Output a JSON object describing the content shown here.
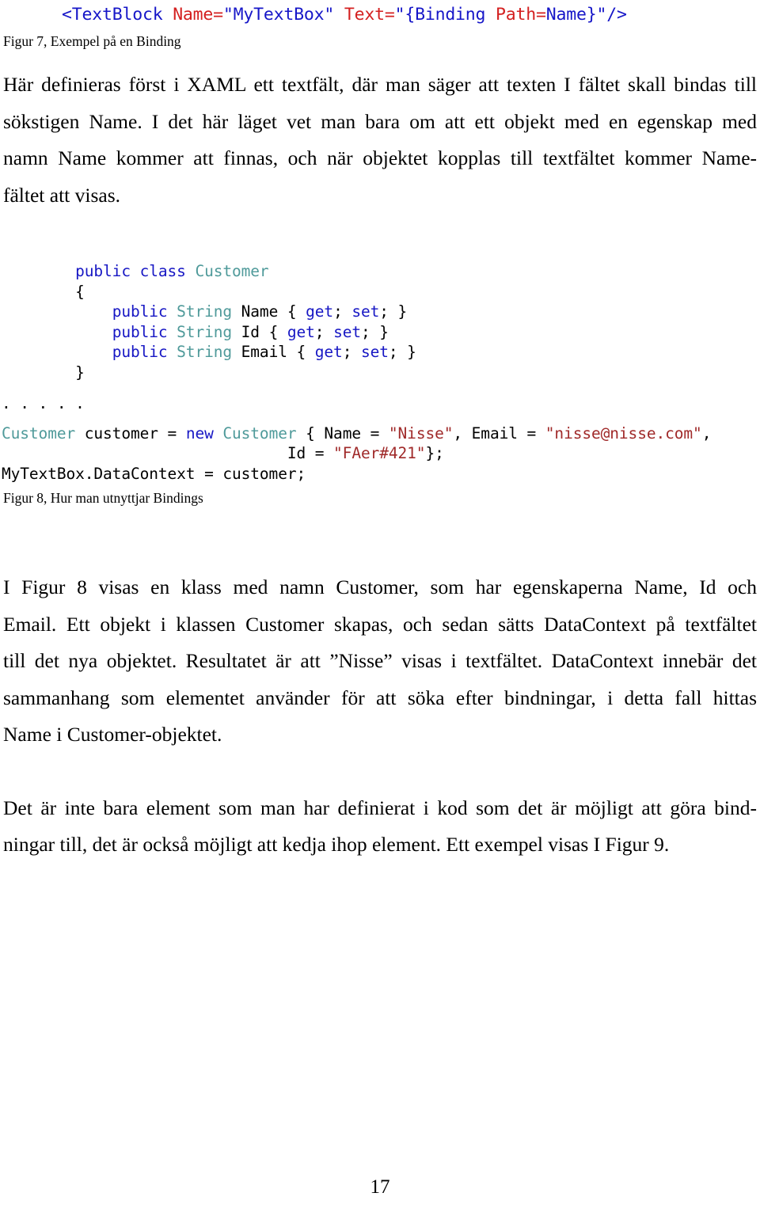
{
  "document": {
    "page_number": "17",
    "language": "sv"
  },
  "figure7": {
    "code_tokens": [
      {
        "text": "<TextBlock ",
        "kind": "tag"
      },
      {
        "text": "Name=",
        "kind": "attr"
      },
      {
        "text": "\"MyTextBox\" ",
        "kind": "val"
      },
      {
        "text": "Text=",
        "kind": "attr"
      },
      {
        "text": "\"{Binding ",
        "kind": "val"
      },
      {
        "text": "Path=",
        "kind": "attr"
      },
      {
        "text": "Name}\"/>",
        "kind": "val"
      }
    ],
    "code_plain": "<TextBlock Name=\"MyTextBox\" Text=\"{Binding Path=Name}\"/>",
    "caption": "Figur 7, Exempel på en Binding",
    "colors": {
      "tag": "#1616c8",
      "attribute": "#d42020",
      "value": "#1616c8"
    }
  },
  "paragraph1": {
    "line1": "Här definieras först i XAML ett textfält, där man säger att texten I fältet skall bindas till",
    "line2": "sökstigen Name. I det här läget vet man bara om att ett objekt med en egenskap med",
    "line3": "namn Name kommer att finnas, och när objektet kopplas till textfältet kommer Name-",
    "line4": "fältet att visas.",
    "full": "Här definieras först i XAML ett textfält, där man säger att texten I fältet skall bindas till sökstigen Name. I det här läget vet man bara om att ett objekt med en egenskap med namn Name kommer att finnas, och när objektet kopplas till textfältet kommer Name-fältet att visas."
  },
  "figure8": {
    "caption": "Figur 8, Hur man utnyttjar Bindings",
    "lines": [
      {
        "indent": 4,
        "tokens": [
          {
            "text": "public",
            "kind": "kw"
          },
          {
            "text": " ",
            "kind": "plain"
          },
          {
            "text": "class",
            "kind": "kw"
          },
          {
            "text": " ",
            "kind": "plain"
          },
          {
            "text": "Customer",
            "kind": "type"
          }
        ]
      },
      {
        "indent": 4,
        "tokens": [
          {
            "text": "{",
            "kind": "plain"
          }
        ]
      },
      {
        "indent": 8,
        "tokens": [
          {
            "text": "public",
            "kind": "kw"
          },
          {
            "text": " ",
            "kind": "plain"
          },
          {
            "text": "String",
            "kind": "type"
          },
          {
            "text": " Name { ",
            "kind": "plain"
          },
          {
            "text": "get",
            "kind": "kw"
          },
          {
            "text": "; ",
            "kind": "plain"
          },
          {
            "text": "set",
            "kind": "kw"
          },
          {
            "text": "; }",
            "kind": "plain"
          }
        ]
      },
      {
        "indent": 8,
        "tokens": [
          {
            "text": "public",
            "kind": "kw"
          },
          {
            "text": " ",
            "kind": "plain"
          },
          {
            "text": "String",
            "kind": "type"
          },
          {
            "text": " Id { ",
            "kind": "plain"
          },
          {
            "text": "get",
            "kind": "kw"
          },
          {
            "text": "; ",
            "kind": "plain"
          },
          {
            "text": "set",
            "kind": "kw"
          },
          {
            "text": "; }",
            "kind": "plain"
          }
        ]
      },
      {
        "indent": 8,
        "tokens": [
          {
            "text": "public",
            "kind": "kw"
          },
          {
            "text": " ",
            "kind": "plain"
          },
          {
            "text": "String",
            "kind": "type"
          },
          {
            "text": " Email { ",
            "kind": "plain"
          },
          {
            "text": "get",
            "kind": "kw"
          },
          {
            "text": "; ",
            "kind": "plain"
          },
          {
            "text": "set",
            "kind": "kw"
          },
          {
            "text": "; }",
            "kind": "plain"
          }
        ]
      },
      {
        "indent": 4,
        "tokens": [
          {
            "text": "}",
            "kind": "plain"
          }
        ]
      }
    ],
    "ellipsis_line": ". . . . .",
    "statement_lines": [
      {
        "indent": 0,
        "tokens": [
          {
            "text": "Customer",
            "kind": "type"
          },
          {
            "text": " customer = ",
            "kind": "plain"
          },
          {
            "text": "new",
            "kind": "kw"
          },
          {
            "text": " ",
            "kind": "plain"
          },
          {
            "text": "Customer",
            "kind": "type"
          },
          {
            "text": " { Name = ",
            "kind": "plain"
          },
          {
            "text": "\"Nisse\"",
            "kind": "str"
          },
          {
            "text": ", Email = ",
            "kind": "plain"
          },
          {
            "text": "\"nisse@nisse.com\"",
            "kind": "str"
          },
          {
            "text": ",",
            "kind": "plain"
          }
        ]
      },
      {
        "indent": 31,
        "tokens": [
          {
            "text": "Id = ",
            "kind": "plain"
          },
          {
            "text": "\"FAer#421\"",
            "kind": "str"
          },
          {
            "text": "};",
            "kind": "plain"
          }
        ]
      },
      {
        "indent": 0,
        "tokens": [
          {
            "text": "MyTextBox.DataContext = customer;",
            "kind": "plain"
          }
        ]
      }
    ],
    "colors": {
      "keyword": "#1717c4",
      "type": "#4f9a9a",
      "string": "#a02a2a",
      "plain": "#000000"
    }
  },
  "paragraph2": {
    "line1": "I Figur 8 visas en klass med namn Customer, som har egenskaperna Name, Id och",
    "line2": "Email. Ett objekt i klassen Customer skapas, och sedan sätts DataContext på textfältet",
    "line3": "till det nya objektet. Resultatet är att ”Nisse” visas i textfältet. DataContext innebär det",
    "line4": "sammanhang som elementet använder för att söka efter bindningar, i detta fall hittas",
    "line5": "Name i Customer-objektet.",
    "full": "I Figur 8 visas en klass med namn Customer, som har egenskaperna Name, Id och Email. Ett objekt i klassen Customer skapas, och sedan sätts DataContext på textfältet till det nya objektet. Resultatet är att ”Nisse” visas i textfältet. DataContext innebär det sammanhang som elementet använder för att söka efter bindningar, i detta fall hittas Name i Customer-objektet."
  },
  "paragraph3": {
    "line1": "Det är inte bara element som man har definierat i kod som det är möjligt att göra bind-",
    "line2": "ningar till, det är också möjligt att kedja ihop element. Ett exempel visas I Figur 9.",
    "full": "Det är inte bara element som man har definierat i kod som det är möjligt att göra bindningar till, det är också möjligt att kedja ihop element. Ett exempel visas I Figur 9."
  }
}
